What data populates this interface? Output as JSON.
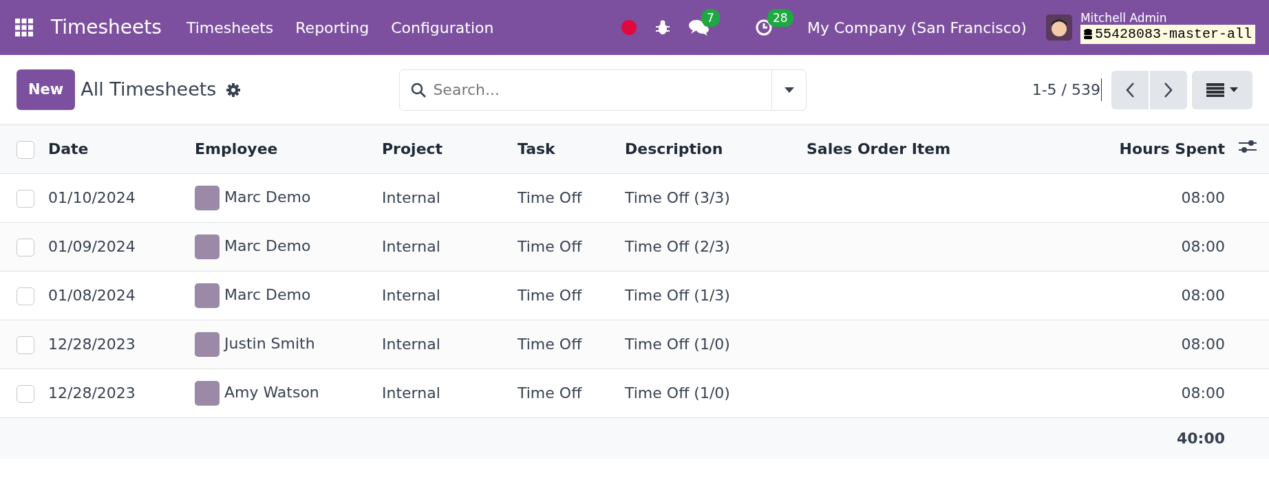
{
  "navbar": {
    "app_name": "Timesheets",
    "menu": [
      "Timesheets",
      "Reporting",
      "Configuration"
    ],
    "messages_count": "7",
    "activities_count": "28",
    "company": "My Company (San Francisco)",
    "user_name": "Mitchell Admin",
    "database": "55428083-master-all"
  },
  "control_panel": {
    "new_button": "New",
    "title": "All Timesheets",
    "search": {
      "placeholder": "Search..."
    },
    "pager": "1-5 / 539"
  },
  "table": {
    "select_all": {
      "checked": false
    },
    "columns": [
      "Date",
      "Employee",
      "Project",
      "Task",
      "Description",
      "Sales Order Item",
      "Hours Spent"
    ],
    "rows": [
      {
        "selected": false,
        "date": "01/10/2024",
        "employee": "Marc Demo",
        "project": "Internal",
        "task": "Time Off",
        "description": "Time Off (3/3)",
        "hours": "08:00"
      },
      {
        "selected": false,
        "date": "01/09/2024",
        "employee": "Marc Demo",
        "project": "Internal",
        "task": "Time Off",
        "description": "Time Off (2/3)",
        "hours": "08:00"
      },
      {
        "selected": false,
        "date": "01/08/2024",
        "employee": "Marc Demo",
        "project": "Internal",
        "task": "Time Off",
        "description": "Time Off (1/3)",
        "hours": "08:00"
      },
      {
        "selected": false,
        "date": "12/28/2023",
        "employee": "Justin Smith",
        "project": "Internal",
        "task": "Time Off",
        "description": "Time Off (1/0)",
        "hours": "08:00"
      },
      {
        "selected": false,
        "date": "12/28/2023",
        "employee": "Amy Watson",
        "project": "Internal",
        "task": "Time Off",
        "description": "Time Off (1/0)",
        "hours": "08:00"
      }
    ],
    "total": "40:00"
  }
}
